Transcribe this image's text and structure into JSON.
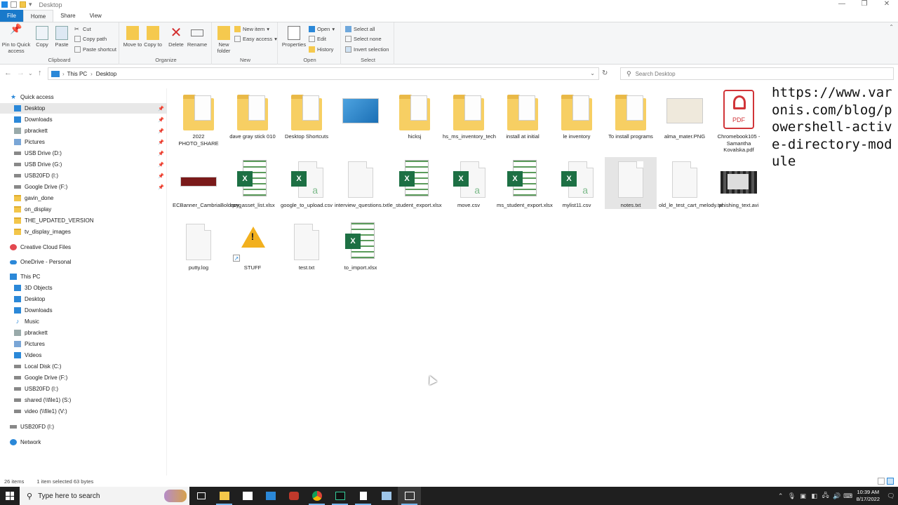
{
  "window": {
    "title": "Desktop",
    "controls": {
      "minimize": "—",
      "restore": "❐",
      "close": "✕"
    }
  },
  "ribbon_tabs": [
    "File",
    "Home",
    "Share",
    "View"
  ],
  "ribbon": {
    "clipboard": {
      "label": "Clipboard",
      "pin": "Pin to Quick access",
      "copy": "Copy",
      "paste": "Paste",
      "cut": "Cut",
      "copy_path": "Copy path",
      "paste_shortcut": "Paste shortcut"
    },
    "organize": {
      "label": "Organize",
      "move_to": "Move to",
      "copy_to": "Copy to",
      "delete": "Delete",
      "rename": "Rename"
    },
    "new": {
      "label": "New",
      "new_folder": "New folder",
      "new_item": "New item",
      "easy_access": "Easy access"
    },
    "open": {
      "label": "Open",
      "properties": "Properties",
      "open": "Open",
      "edit": "Edit",
      "history": "History"
    },
    "select": {
      "label": "Select",
      "select_all": "Select all",
      "select_none": "Select none",
      "invert": "Invert selection"
    }
  },
  "address": {
    "crumbs": [
      "This PC",
      "Desktop"
    ],
    "search_placeholder": "Search Desktop"
  },
  "sidebar": {
    "quick_access": "Quick access",
    "quick_items": [
      {
        "label": "Desktop",
        "icon": "desktop-icon",
        "pinned": true
      },
      {
        "label": "Downloads",
        "icon": "downloads-icon",
        "pinned": true
      },
      {
        "label": "pbrackett",
        "icon": "user-folder-icon",
        "pinned": true
      },
      {
        "label": "Pictures",
        "icon": "pictures-icon",
        "pinned": true
      },
      {
        "label": "USB Drive (D:)",
        "icon": "drive-icon",
        "pinned": true
      },
      {
        "label": "USB Drive (G:)",
        "icon": "drive-icon",
        "pinned": true
      },
      {
        "label": "USB20FD (I:)",
        "icon": "drive-icon",
        "pinned": true
      },
      {
        "label": "Google Drive (F:)",
        "icon": "drive-icon",
        "pinned": true
      },
      {
        "label": "gavin_done",
        "icon": "folder-icon",
        "pinned": false
      },
      {
        "label": "on_display",
        "icon": "folder-icon",
        "pinned": false
      },
      {
        "label": "THE_UPDATED_VERSION",
        "icon": "folder-icon",
        "pinned": false
      },
      {
        "label": "tv_display_images",
        "icon": "folder-icon",
        "pinned": false
      }
    ],
    "creative_cloud": "Creative Cloud Files",
    "onedrive": "OneDrive - Personal",
    "this_pc": "This PC",
    "pc_items": [
      {
        "label": "3D Objects",
        "icon": "3d-objects-icon"
      },
      {
        "label": "Desktop",
        "icon": "desktop-icon"
      },
      {
        "label": "Downloads",
        "icon": "downloads-icon"
      },
      {
        "label": "Music",
        "icon": "music-icon"
      },
      {
        "label": "pbrackett",
        "icon": "user-folder-icon"
      },
      {
        "label": "Pictures",
        "icon": "pictures-icon"
      },
      {
        "label": "Videos",
        "icon": "videos-icon"
      },
      {
        "label": "Local Disk (C:)",
        "icon": "drive-icon"
      },
      {
        "label": "Google Drive (F:)",
        "icon": "drive-icon"
      },
      {
        "label": "USB20FD (I:)",
        "icon": "drive-icon"
      },
      {
        "label": "shared (\\\\file1) (S:)",
        "icon": "network-drive-icon"
      },
      {
        "label": "video (\\\\file1) (V:)",
        "icon": "network-drive-icon"
      }
    ],
    "usb": "USB20FD (I:)",
    "network": "Network"
  },
  "files": [
    {
      "name": "2022 PHOTO_SHARE",
      "type": "folder"
    },
    {
      "name": "dave gray stick 010",
      "type": "folder"
    },
    {
      "name": "Desktop Shortcuts",
      "type": "folder"
    },
    {
      "name": "",
      "type": "image"
    },
    {
      "name": "hicksj",
      "type": "folder"
    },
    {
      "name": "hs_ms_inventory_tech",
      "type": "folder"
    },
    {
      "name": "install at initial",
      "type": "folder"
    },
    {
      "name": "le inventory",
      "type": "folder"
    },
    {
      "name": "To install programs",
      "type": "folder"
    },
    {
      "name": "alma_mater.PNG",
      "type": "image"
    },
    {
      "name": "Chromebook105 - Samantha Kovalska.pdf",
      "type": "pdf"
    },
    {
      "name": "ECBanner_CambriaBold.png",
      "type": "image"
    },
    {
      "name": "eoy_asset_list.xlsx",
      "type": "xlsx"
    },
    {
      "name": "google_to_upload.csv",
      "type": "csv"
    },
    {
      "name": "interview_questions.txt",
      "type": "txt"
    },
    {
      "name": "le_student_export.xlsx",
      "type": "xlsx"
    },
    {
      "name": "move.csv",
      "type": "csv"
    },
    {
      "name": "ms_student_export.xlsx",
      "type": "xlsx"
    },
    {
      "name": "mylist11.csv",
      "type": "csv"
    },
    {
      "name": "notes.txt",
      "type": "txt",
      "selected": true
    },
    {
      "name": "old_le_test_cart_melody.txt",
      "type": "txt"
    },
    {
      "name": "phishing_text.avi",
      "type": "video"
    },
    {
      "name": "putty.log",
      "type": "txt"
    },
    {
      "name": "STUFF",
      "type": "shortcut"
    },
    {
      "name": "test.txt",
      "type": "txt"
    },
    {
      "name": "to_import.xlsx",
      "type": "xlsx"
    }
  ],
  "pdf_badge": "PDF",
  "overlay_text": "https://www.varonis.com/blog/powershell-active-directory-module",
  "status": {
    "items": "26 items",
    "selected": "1 item selected  63 bytes"
  },
  "taskbar": {
    "search_placeholder": "Type here to search",
    "time": "10:39 AM",
    "date": "8/17/2022"
  }
}
